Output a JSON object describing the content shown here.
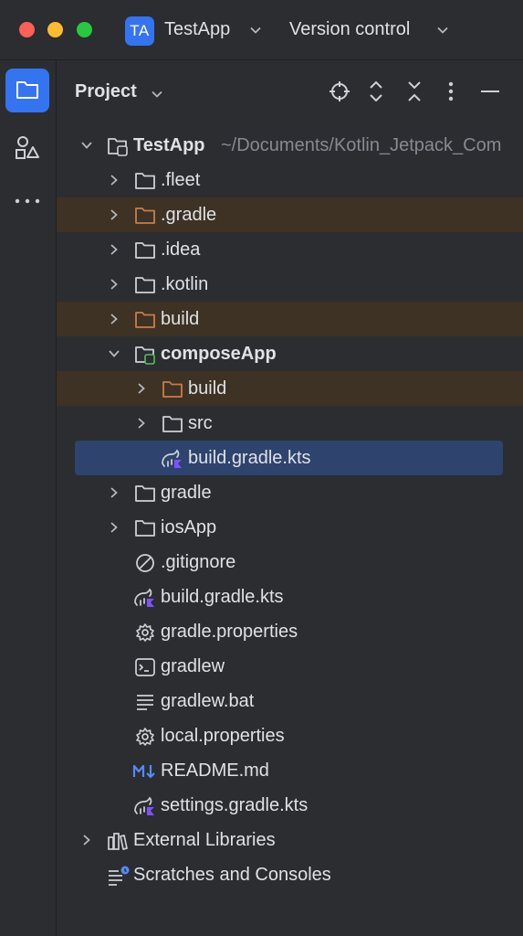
{
  "titlebar": {
    "project_badge": "TA",
    "project_name": "TestApp",
    "vcs_label": "Version control"
  },
  "toolstrip": {
    "items": [
      "project-tool",
      "structure-tool",
      "more-tools"
    ]
  },
  "panel": {
    "title": "Project",
    "header_icons": [
      "locate-icon",
      "expand-all-icon",
      "collapse-all-icon",
      "options-icon",
      "hide-icon"
    ]
  },
  "tree": {
    "root_label": "TestApp",
    "root_path": "~/Documents/Kotlin_Jetpack_Com",
    "fleet": ".fleet",
    "gradle_dir": ".gradle",
    "idea": ".idea",
    "kotlin": ".kotlin",
    "build": "build",
    "composeApp": "composeApp",
    "composeApp_build": "build",
    "composeApp_src": "src",
    "composeApp_gradle_kts": "build.gradle.kts",
    "gradle": "gradle",
    "iosApp": "iosApp",
    "gitignore": ".gitignore",
    "build_gradle_kts": "build.gradle.kts",
    "gradle_properties": "gradle.properties",
    "gradlew": "gradlew",
    "gradlew_bat": "gradlew.bat",
    "local_properties": "local.properties",
    "readme": "README.md",
    "settings_gradle_kts": "settings.gradle.kts",
    "external_libraries": "External Libraries",
    "scratches": "Scratches and Consoles"
  },
  "colors": {
    "accent": "#3574f0",
    "excluded_bg": "#3d3223",
    "selected_bg": "#2e436e",
    "excluded_folder": "#c77d4a"
  }
}
